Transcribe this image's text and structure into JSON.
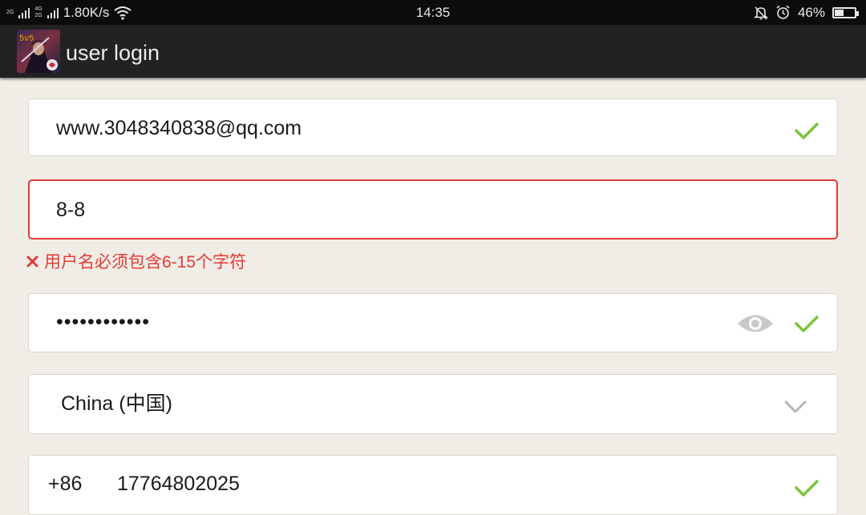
{
  "status_bar": {
    "network_top": "2G",
    "network_mid": "4G",
    "network_bottom": "2G",
    "speed": "1.80K/s",
    "time": "14:35",
    "battery": "46%",
    "battery_level": 0.46
  },
  "app_bar": {
    "icon_text": "5v5",
    "title": "user login"
  },
  "form": {
    "email_value": "www.3048340838@qq.com",
    "username_value": "8-8",
    "username_error": "用户名必须包含6-15个字符",
    "password_value": "••••••••••••",
    "country_value": "China (中国)",
    "phone_code": "+86",
    "phone_number": "17764802025"
  },
  "colors": {
    "valid": "#7cc43a",
    "error": "#e53935"
  }
}
